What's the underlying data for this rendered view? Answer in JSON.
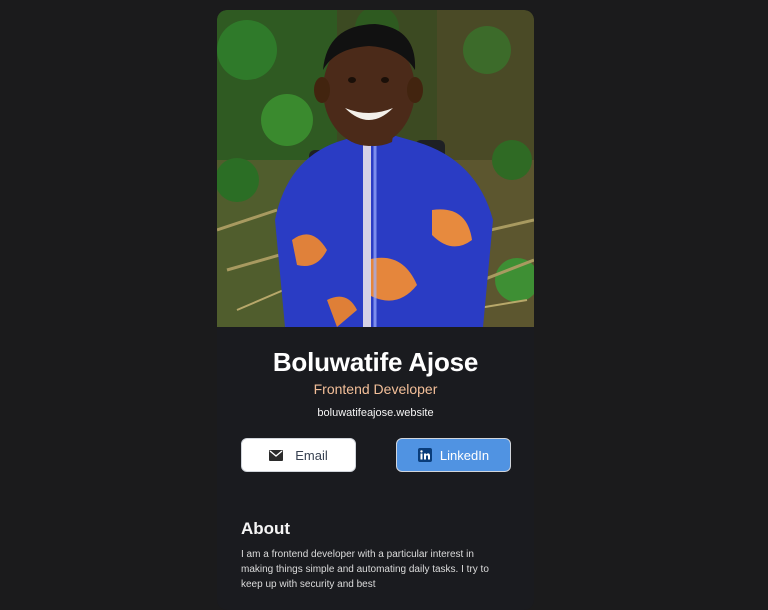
{
  "profile": {
    "name": "Boluwatife Ajose",
    "title": "Frontend Developer",
    "website": "boluwatifeajose.website"
  },
  "buttons": {
    "email_label": "Email",
    "linkedin_label": "LinkedIn"
  },
  "about": {
    "heading": "About",
    "text": "I am a frontend developer with a particular interest in making things simple and automating daily tasks. I try to keep up with security and best"
  },
  "icons": {
    "email": "mail-icon",
    "linkedin": "linkedin-icon"
  },
  "colors": {
    "background": "#1b1b1c",
    "card": "#1a1b1f",
    "accent_title": "#f3bf99",
    "linkedin_button": "#5093e2"
  }
}
